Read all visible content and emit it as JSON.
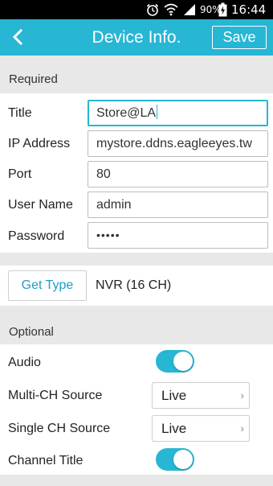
{
  "status_bar": {
    "alarm_icon": "alarm-clock-icon",
    "wifi_icon": "wifi-icon",
    "signal_icon": "cell-signal-icon",
    "battery_percent": "90%",
    "battery_icon": "battery-charging-icon",
    "time": "16:44"
  },
  "app_bar": {
    "back_icon": "chevron-left-icon",
    "title": "Device Info.",
    "save_label": "Save",
    "color": "#27b6d4"
  },
  "required": {
    "header": "Required",
    "fields": {
      "title": {
        "label": "Title",
        "value": "Store@LA"
      },
      "ip_address": {
        "label": "IP Address",
        "value": "mystore.ddns.eagleeyes.tw"
      },
      "port": {
        "label": "Port",
        "value": "80"
      },
      "user_name": {
        "label": "User Name",
        "value": "admin"
      },
      "password": {
        "label": "Password",
        "value": "•••••"
      }
    }
  },
  "device_type": {
    "button_label": "Get Type",
    "value": "NVR (16 CH)"
  },
  "optional": {
    "header": "Optional",
    "audio": {
      "label": "Audio",
      "on": true
    },
    "multi_ch_source": {
      "label": "Multi-CH Source",
      "value": "Live",
      "chevron": "›"
    },
    "single_ch_source": {
      "label": "Single CH Source",
      "value": "Live",
      "chevron": "›"
    },
    "channel_title": {
      "label": "Channel Title",
      "on": true
    }
  }
}
